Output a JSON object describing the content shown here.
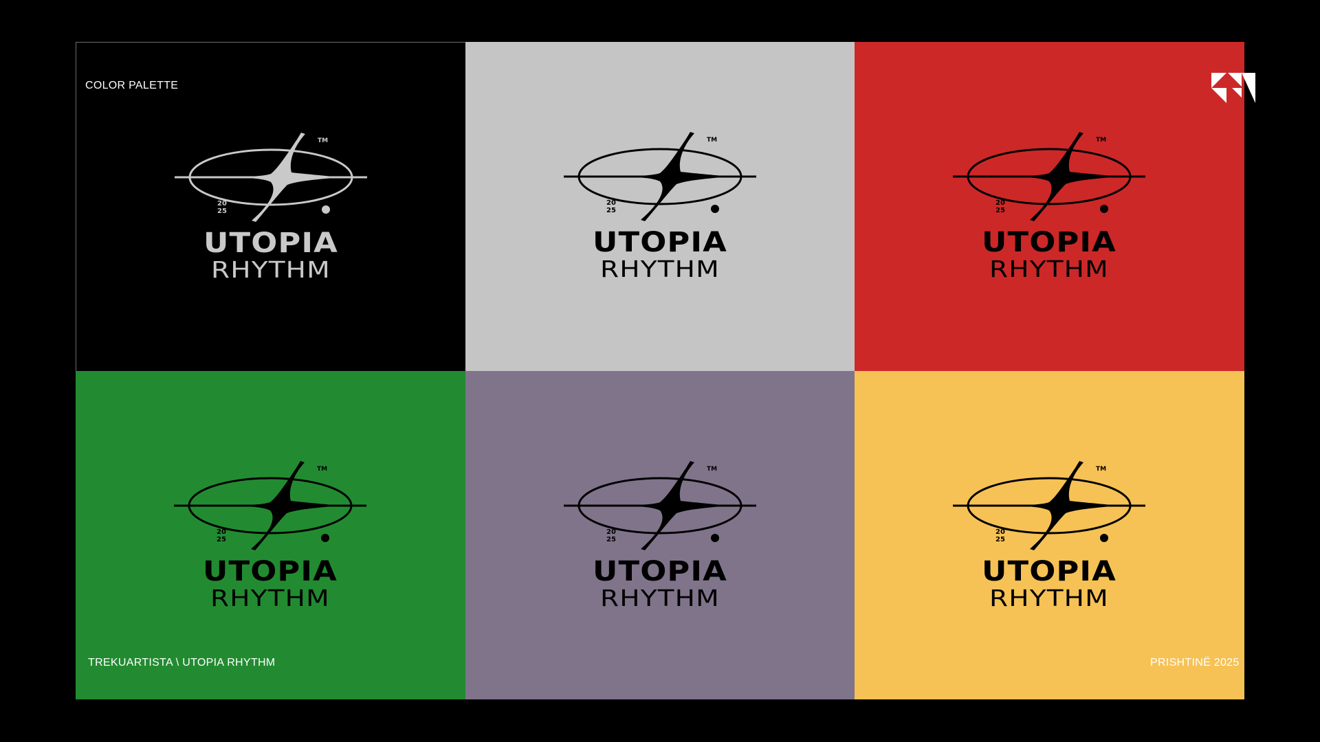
{
  "slide": {
    "title": "COLOR PALETTE",
    "footer_left": "TREKUARTISTA \\ UTOPIA RHYTHM",
    "footer_right": "PRISHTINË 2025"
  },
  "brand_mark": {
    "icon": "trekuartista-mark-icon",
    "color": "#ffffff"
  },
  "logo": {
    "line1": "UTOPIA",
    "line2": "RHYTHM",
    "year_top": "20",
    "year_bottom": "25",
    "trademark": "TM"
  },
  "panels": [
    {
      "name": "black",
      "background": "#000000",
      "logo_color": "#c9c9c9"
    },
    {
      "name": "grey",
      "background": "#c5c5c5",
      "logo_color": "#000000"
    },
    {
      "name": "red",
      "background": "#cc2828",
      "logo_color": "#000000"
    },
    {
      "name": "green",
      "background": "#228b31",
      "logo_color": "#000000"
    },
    {
      "name": "purple",
      "background": "#80748b",
      "logo_color": "#000000"
    },
    {
      "name": "yellow",
      "background": "#f6c255",
      "logo_color": "#000000"
    }
  ]
}
